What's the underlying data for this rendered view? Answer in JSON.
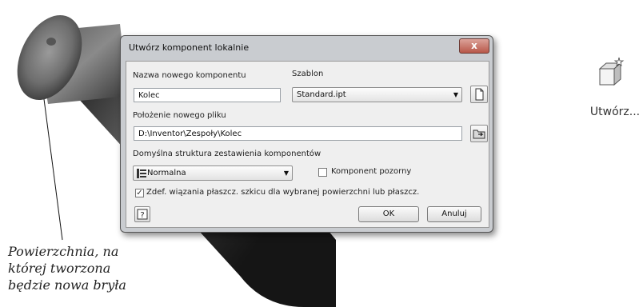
{
  "dialog": {
    "title": "Utwórz komponent lokalnie",
    "close_label": "x",
    "component_name_label": "Nazwa nowego komponentu",
    "component_name_value": "Kolec",
    "template_label": "Szablon",
    "template_value": "Standard.ipt",
    "file_location_label": "Położenie nowego pliku",
    "file_location_value": "D:\\Inventor\\Zespoły\\Kolec",
    "bom_structure_label": "Domyślna struktura zestawienia komponentów",
    "bom_structure_value": "Normalna",
    "virtual_component_label": "Komponent pozorny",
    "virtual_component_checked": false,
    "constrain_sketch_label": "Zdef. wiązania płaszcz. szkicu dla wybranej powierzchni lub płaszcz.",
    "constrain_sketch_checked": true,
    "ok_label": "OK",
    "cancel_label": "Anuluj"
  },
  "ribbon": {
    "create_label": "Utwórz..."
  },
  "caption": {
    "line1": "Powierzchnia, na",
    "line2": "której tworzona",
    "line3": "będzie nowa bryła"
  }
}
